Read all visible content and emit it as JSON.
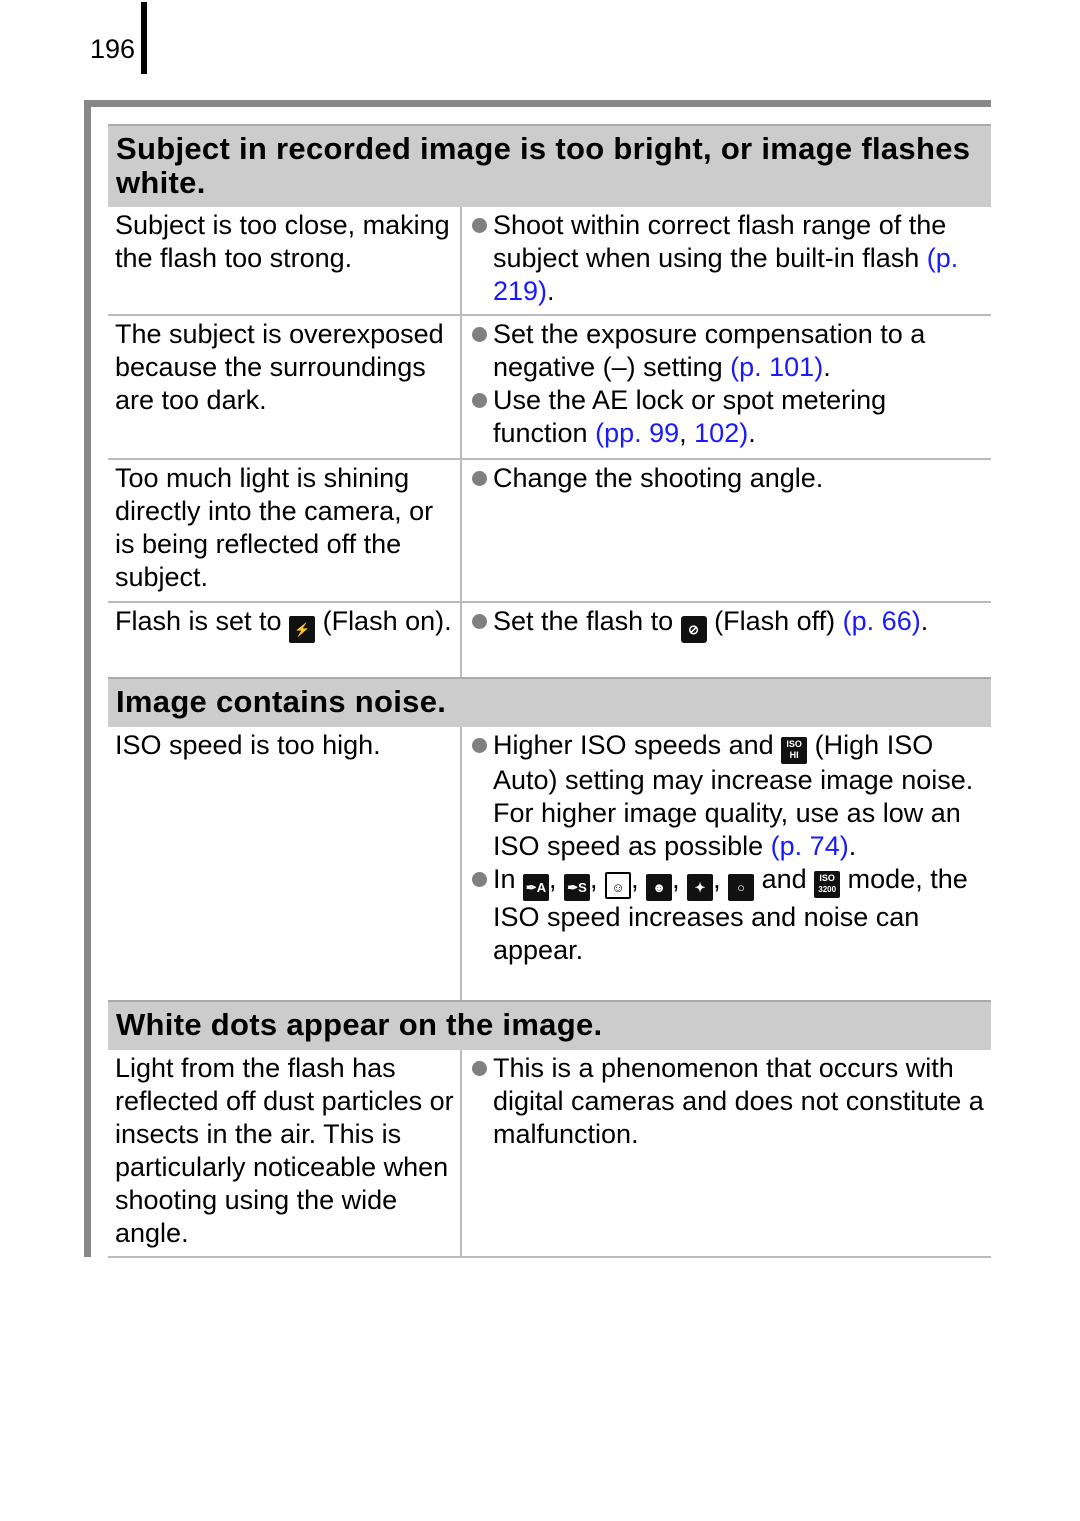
{
  "page_number": "196",
  "sections": [
    {
      "title": "Subject in recorded image is too bright, or image flashes white.",
      "rows": [
        {
          "cause": "Subject is too close, making the flash too strong.",
          "solutions": [
            {
              "text": "Shoot within correct flash range of the subject when using the built-in flash ",
              "link": "(p. 219)",
              "after": "."
            }
          ]
        },
        {
          "cause": "The subject is overexposed because the surroundings are too dark.",
          "solutions": [
            {
              "text": "Set the exposure compensation to a negative (–) setting ",
              "link": "(p. 101)",
              "after": "."
            },
            {
              "text": "Use the AE lock or spot metering function ",
              "link": "(pp. 99",
              "mid": ", ",
              "link2": "102)",
              "after": "."
            }
          ]
        },
        {
          "cause": "Too much light is shining directly into the camera, or is being reflected off the subject.",
          "solutions": [
            {
              "text": "Change the shooting angle."
            }
          ]
        },
        {
          "cause_before": "Flash is set to ",
          "cause_icon": "flash-on-icon",
          "cause_after": " (Flash on).",
          "solutions": [
            {
              "text": "Set the flash to ",
              "icon": "flash-off-icon",
              "text2": " (Flash off) ",
              "link": "(p. 66)",
              "after": "."
            }
          ]
        }
      ]
    },
    {
      "title": "Image contains noise.",
      "rows": [
        {
          "cause": "ISO speed is too high.",
          "solutions": [
            {
              "text": "Higher ISO speeds and ",
              "icon": "iso-hi-icon",
              "icon_label_top": "ISO",
              "icon_label_bottom": "HI",
              "text2": " (High ISO Auto) setting may increase image noise. For higher image quality, use as low an ISO speed as possible ",
              "link": "(p. 74)",
              "after": "."
            },
            {
              "text": "In ",
              "icons": [
                "kids-pets-auto-icon",
                "kids-pets-slow-icon",
                "night-snapshot-icon",
                "indoor-icon",
                "party-icon",
                "aquarium-icon"
              ],
              "icon_labels": [
                "A",
                "S",
                "A",
                "",
                "",
                ""
              ],
              "and": " and ",
              "last_icon": "iso-3200-icon",
              "last_icon_top": "ISO",
              "last_icon_bottom": "3200",
              "text2": " mode, the ISO speed increases and noise can appear."
            }
          ]
        }
      ]
    },
    {
      "title": "White dots appear on the image.",
      "rows": [
        {
          "cause": "Light from the flash has reflected off dust particles or insects in the air. This is particularly noticeable when shooting using the wide angle.",
          "solutions": [
            {
              "text": "This is a phenomenon that occurs with digital cameras and does not constitute a malfunction."
            }
          ]
        }
      ]
    }
  ]
}
